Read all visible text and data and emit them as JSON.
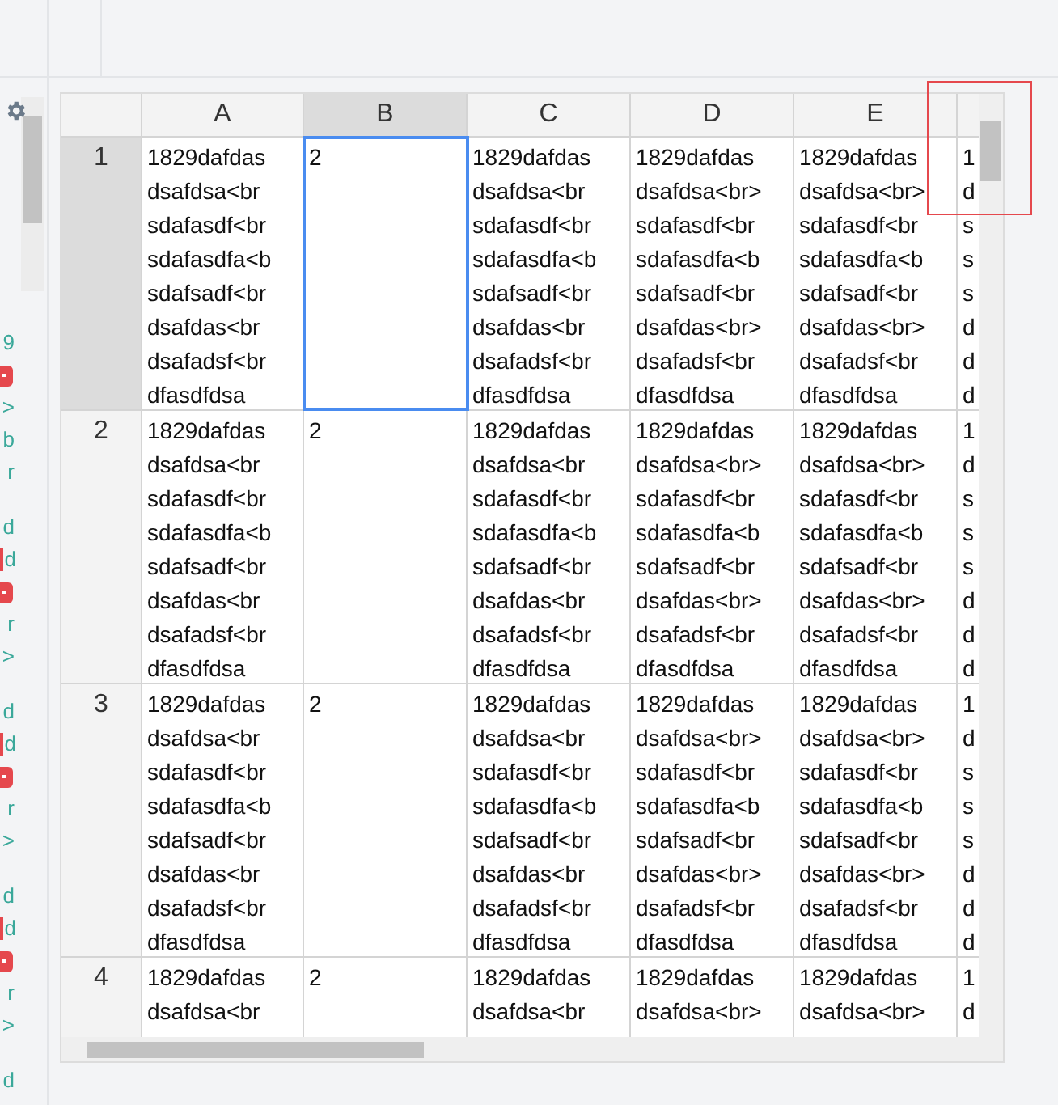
{
  "sidebar": {
    "groups": [
      {
        "fragments": [
          {
            "kind": "text",
            "text": "9"
          },
          {
            "kind": "badge"
          },
          {
            "kind": "text",
            "text": ">"
          },
          {
            "kind": "text",
            "text": "b"
          },
          {
            "kind": "text",
            "text": "r"
          }
        ]
      },
      {
        "fragments": [
          {
            "kind": "text",
            "text": "d"
          },
          {
            "kind": "marked",
            "text": "d"
          },
          {
            "kind": "badge"
          },
          {
            "kind": "text",
            "text": "r"
          },
          {
            "kind": "text",
            "text": ">"
          }
        ]
      },
      {
        "fragments": [
          {
            "kind": "text",
            "text": "d"
          },
          {
            "kind": "marked",
            "text": "d"
          },
          {
            "kind": "badge"
          },
          {
            "kind": "text",
            "text": "r"
          },
          {
            "kind": "text",
            "text": ">"
          }
        ]
      },
      {
        "fragments": [
          {
            "kind": "text",
            "text": "d"
          },
          {
            "kind": "marked",
            "text": "d"
          },
          {
            "kind": "badge"
          },
          {
            "kind": "text",
            "text": "r"
          },
          {
            "kind": "text",
            "text": ">"
          }
        ]
      },
      {
        "fragments": [
          {
            "kind": "text",
            "text": "d"
          }
        ]
      }
    ]
  },
  "grid": {
    "columns": [
      {
        "label": "A",
        "selected": false
      },
      {
        "label": "B",
        "selected": true
      },
      {
        "label": "C",
        "selected": false
      },
      {
        "label": "D",
        "selected": false
      },
      {
        "label": "E",
        "selected": false
      }
    ],
    "rows": [
      {
        "label": "1",
        "selected": true,
        "cells": [
          {
            "selected": false,
            "lines": [
              "1829dafdas",
              "dsafdsa<br",
              "sdafasdf<br",
              "sdafasdfa<b",
              "sdafsadf<br",
              "dsafdas<br",
              "dsafadsf<br",
              "dfasdfdsa"
            ]
          },
          {
            "selected": true,
            "lines": [
              "2"
            ]
          },
          {
            "selected": false,
            "lines": [
              "1829dafdas",
              "dsafdsa<br",
              "sdafasdf<br",
              "sdafasdfa<b",
              "sdafsadf<br",
              "dsafdas<br",
              "dsafadsf<br",
              "dfasdfdsa"
            ]
          },
          {
            "selected": false,
            "lines": [
              "1829dafdas",
              "dsafdsa<br>",
              "sdafasdf<br",
              "sdafasdfa<b",
              "sdafsadf<br",
              "dsafdas<br>",
              "dsafadsf<br",
              "dfasdfdsa"
            ]
          },
          {
            "selected": false,
            "lines": [
              "1829dafdas",
              "dsafdsa<br>",
              "sdafasdf<br",
              "sdafasdfa<b",
              "sdafsadf<br",
              "dsafdas<br>",
              "dsafadsf<br",
              "dfasdfdsa"
            ]
          },
          {
            "selected": false,
            "lines": [
              "1",
              "d",
              "s",
              "s",
              "s",
              "d",
              "d",
              "d"
            ]
          }
        ]
      },
      {
        "label": "2",
        "selected": false,
        "cells": [
          {
            "selected": false,
            "lines": [
              "1829dafdas",
              "dsafdsa<br",
              "sdafasdf<br",
              "sdafasdfa<b",
              "sdafsadf<br",
              "dsafdas<br",
              "dsafadsf<br",
              "dfasdfdsa"
            ]
          },
          {
            "selected": false,
            "lines": [
              "2"
            ]
          },
          {
            "selected": false,
            "lines": [
              "1829dafdas",
              "dsafdsa<br",
              "sdafasdf<br",
              "sdafasdfa<b",
              "sdafsadf<br",
              "dsafdas<br",
              "dsafadsf<br",
              "dfasdfdsa"
            ]
          },
          {
            "selected": false,
            "lines": [
              "1829dafdas",
              "dsafdsa<br>",
              "sdafasdf<br",
              "sdafasdfa<b",
              "sdafsadf<br",
              "dsafdas<br>",
              "dsafadsf<br",
              "dfasdfdsa"
            ]
          },
          {
            "selected": false,
            "lines": [
              "1829dafdas",
              "dsafdsa<br>",
              "sdafasdf<br",
              "sdafasdfa<b",
              "sdafsadf<br",
              "dsafdas<br>",
              "dsafadsf<br",
              "dfasdfdsa"
            ]
          },
          {
            "selected": false,
            "lines": [
              "1",
              "d",
              "s",
              "s",
              "s",
              "d",
              "d",
              "d"
            ]
          }
        ]
      },
      {
        "label": "3",
        "selected": false,
        "cells": [
          {
            "selected": false,
            "lines": [
              "1829dafdas",
              "dsafdsa<br",
              "sdafasdf<br",
              "sdafasdfa<b",
              "sdafsadf<br",
              "dsafdas<br",
              "dsafadsf<br",
              "dfasdfdsa"
            ]
          },
          {
            "selected": false,
            "lines": [
              "2"
            ]
          },
          {
            "selected": false,
            "lines": [
              "1829dafdas",
              "dsafdsa<br",
              "sdafasdf<br",
              "sdafasdfa<b",
              "sdafsadf<br",
              "dsafdas<br",
              "dsafadsf<br",
              "dfasdfdsa"
            ]
          },
          {
            "selected": false,
            "lines": [
              "1829dafdas",
              "dsafdsa<br>",
              "sdafasdf<br",
              "sdafasdfa<b",
              "sdafsadf<br",
              "dsafdas<br>",
              "dsafadsf<br",
              "dfasdfdsa"
            ]
          },
          {
            "selected": false,
            "lines": [
              "1829dafdas",
              "dsafdsa<br>",
              "sdafasdf<br",
              "sdafasdfa<b",
              "sdafsadf<br",
              "dsafdas<br>",
              "dsafadsf<br",
              "dfasdfdsa"
            ]
          },
          {
            "selected": false,
            "lines": [
              "1",
              "d",
              "s",
              "s",
              "s",
              "d",
              "d",
              "d"
            ]
          }
        ]
      },
      {
        "label": "4",
        "selected": false,
        "cells": [
          {
            "selected": false,
            "lines": [
              "1829dafdas",
              "dsafdsa<br"
            ]
          },
          {
            "selected": false,
            "lines": [
              "2"
            ]
          },
          {
            "selected": false,
            "lines": [
              "1829dafdas",
              "dsafdsa<br"
            ]
          },
          {
            "selected": false,
            "lines": [
              "1829dafdas",
              "dsafdsa<br>"
            ]
          },
          {
            "selected": false,
            "lines": [
              "1829dafdas",
              "dsafdsa<br>"
            ]
          },
          {
            "selected": false,
            "lines": [
              "1",
              "d"
            ]
          }
        ]
      }
    ]
  }
}
